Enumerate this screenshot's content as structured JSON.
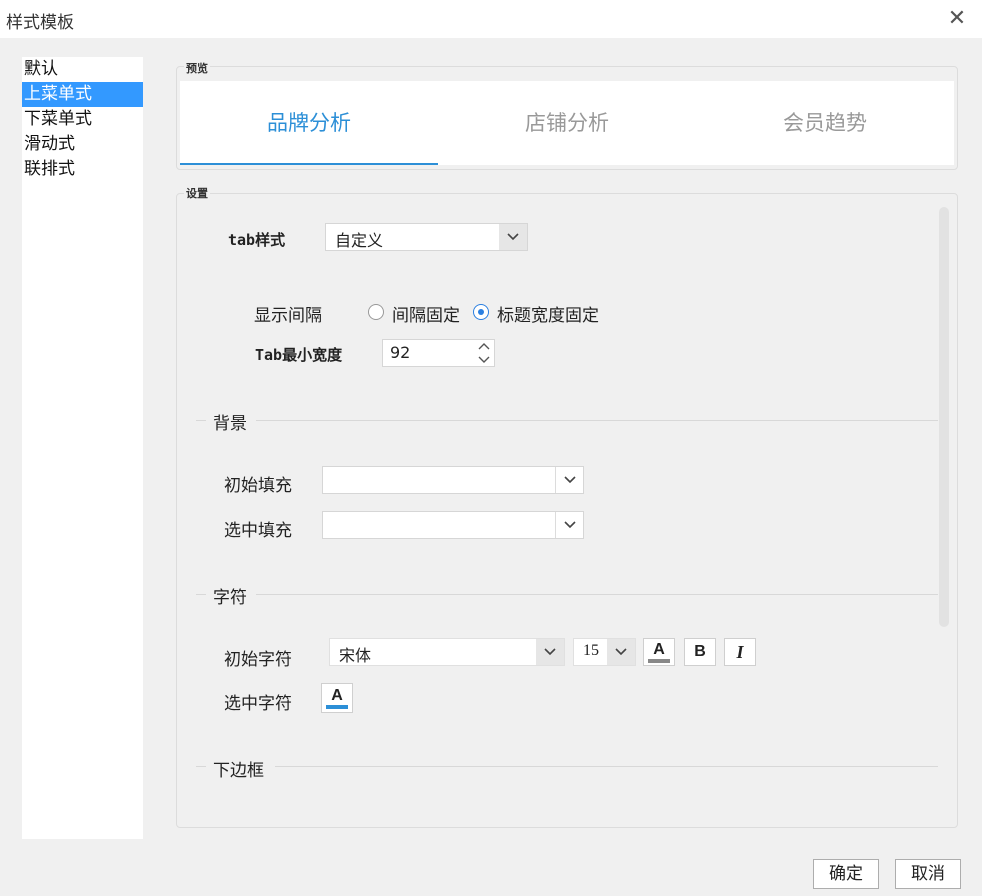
{
  "window": {
    "title": "样式模板",
    "close_glyph": "✕"
  },
  "template_list": [
    "默认",
    "上菜单式",
    "下菜单式",
    "滑动式",
    "联排式"
  ],
  "preview": {
    "label": "预览",
    "tabs": [
      "品牌分析",
      "店铺分析",
      "会员趋势"
    ],
    "active_index": 0,
    "accent": "#2c8fd7"
  },
  "settings": {
    "label": "设置",
    "tab_style": {
      "label": "tab样式",
      "value": "自定义"
    },
    "display_spacing": {
      "label": "显示间隔",
      "options": [
        "间隔固定",
        "标题宽度固定"
      ],
      "selected_index": 1
    },
    "tab_min_width": {
      "label": "Tab最小宽度",
      "value": "92"
    },
    "background": {
      "heading": "背景",
      "initial_fill_label": "初始填充",
      "initial_fill_value": "",
      "selected_fill_label": "选中填充",
      "selected_fill_value": ""
    },
    "font": {
      "heading": "字符",
      "initial_label": "初始字符",
      "font_name": "宋体",
      "font_size": "15",
      "color_letter": "A",
      "initial_color": "#888888",
      "bold_label": "B",
      "italic_label": "I",
      "selected_label": "选中字符",
      "selected_color": "#2c8fd7"
    },
    "bottom_border": {
      "heading": "下边框"
    }
  },
  "buttons": {
    "ok": "确定",
    "cancel": "取消"
  }
}
